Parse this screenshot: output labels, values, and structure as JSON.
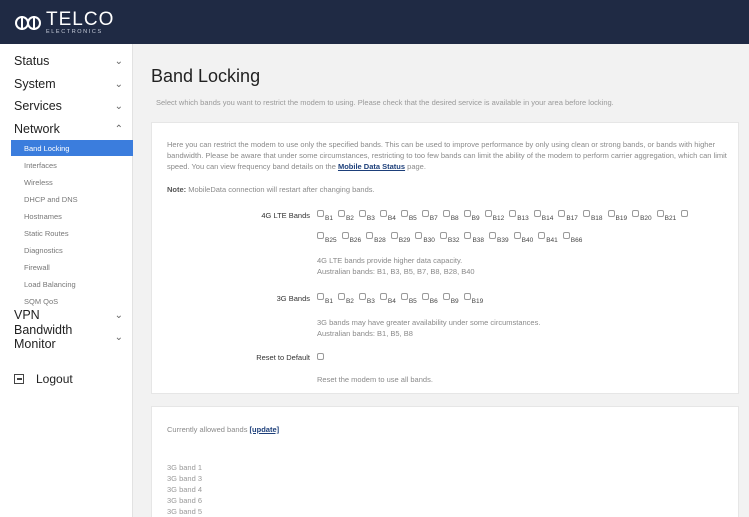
{
  "brand": {
    "name": "TELCO",
    "tagline": "ELECTRONICS"
  },
  "sidebar": {
    "groups": [
      {
        "label": "Status"
      },
      {
        "label": "System"
      },
      {
        "label": "Services"
      },
      {
        "label": "Network"
      },
      {
        "label": "VPN"
      },
      {
        "label": "Bandwidth Monitor"
      }
    ],
    "network_items": [
      "Band Locking",
      "Interfaces",
      "Wireless",
      "DHCP and DNS",
      "Hostnames",
      "Static Routes",
      "Diagnostics",
      "Firewall",
      "Load Balancing",
      "SQM QoS"
    ],
    "logout": "Logout"
  },
  "page": {
    "title": "Band Locking",
    "subtitle": "Select which bands you want to restrict the modem to using. Please check that the desired service is available in your area before locking."
  },
  "intro": {
    "text": "Here you can restrict the modem to use only the specified bands. This can be used to improve performance by only using clean or strong bands, or bands with higher bandwidth. Please be aware that under some circumstances, restricting to too few bands can limit the ability of the modem to perform carrier aggregation, which can limit speed. You can view frequency band details on the ",
    "link": "Mobile Data Status",
    "suffix": " page.",
    "note_label": "Note:",
    "note_text": " MobileData connection will restart after changing bands."
  },
  "lte": {
    "label": "4G LTE Bands",
    "row1": [
      "B1",
      "B2",
      "B3",
      "B4",
      "B5",
      "B7",
      "B8",
      "B9",
      "B12",
      "B13",
      "B14",
      "B17",
      "B18",
      "B19",
      "B20",
      "B21"
    ],
    "row2": [
      "B25",
      "B26",
      "B28",
      "B29",
      "B30",
      "B32",
      "B38",
      "B39",
      "B40",
      "B41",
      "B66"
    ],
    "help1": "4G LTE bands provide higher data capacity.",
    "help2": "Australian bands: B1, B3, B5, B7, B8, B28, B40"
  },
  "g3": {
    "label": "3G Bands",
    "bands": [
      "B1",
      "B2",
      "B3",
      "B4",
      "B5",
      "B6",
      "B9",
      "B19"
    ],
    "help1": "3G bands may have greater availability under some circumstances.",
    "help2": "Australian bands: B1, B5, B8"
  },
  "reset": {
    "label": "Reset to Default",
    "help": "Reset the modem to use all bands."
  },
  "allowed": {
    "title": "Currently allowed bands ",
    "link": "[update]",
    "items": [
      "3G band 1",
      "3G band 3",
      "3G band 4",
      "3G band 6",
      "3G band 5"
    ]
  }
}
